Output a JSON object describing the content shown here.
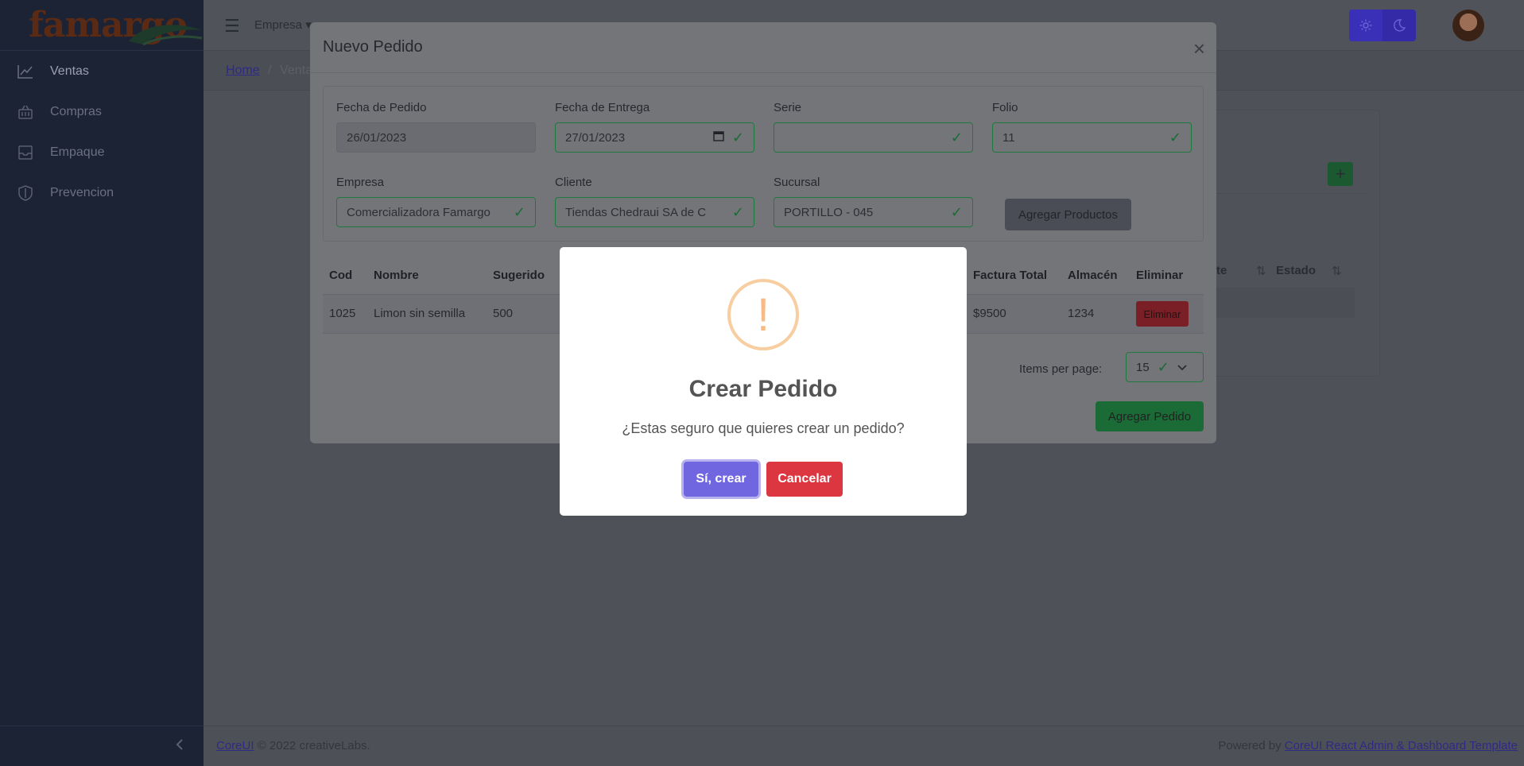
{
  "brand": {
    "logo_text": "famargo"
  },
  "sidebar": {
    "items": [
      {
        "label": "Ventas",
        "icon": "chart-line-icon"
      },
      {
        "label": "Compras",
        "icon": "basket-icon"
      },
      {
        "label": "Empaque",
        "icon": "inbox-icon"
      },
      {
        "label": "Prevencion",
        "icon": "shield-icon"
      }
    ],
    "collapse_icon": "chevron-left-icon"
  },
  "header": {
    "menu_label": "Empresa ▾"
  },
  "breadcrumb": {
    "home": "Home",
    "sep": "/",
    "current": "Venta"
  },
  "background_table": {
    "headers": [
      "te",
      "Estado"
    ]
  },
  "footer": {
    "left_link": "CoreUI",
    "left_text": "© 2022 creativeLabs.",
    "right_text": "Powered by",
    "right_link": "CoreUI React Admin & Dashboard Template"
  },
  "modal": {
    "title": "Nuevo Pedido",
    "close": "×",
    "fields": {
      "fecha_pedido": {
        "label": "Fecha de Pedido",
        "value": "26/01/2023"
      },
      "fecha_entrega": {
        "label": "Fecha de Entrega",
        "value": "27/01/2023"
      },
      "serie": {
        "label": "Serie",
        "value": ""
      },
      "folio": {
        "label": "Folio",
        "value": "11"
      },
      "empresa": {
        "label": "Empresa",
        "value": "Comercializadora Famargo"
      },
      "cliente": {
        "label": "Cliente",
        "value": "Tiendas Chedraui SA de C"
      },
      "sucursal": {
        "label": "Sucursal",
        "value": "PORTILLO - 045"
      }
    },
    "agregar_productos": "Agregar Productos",
    "table": {
      "headers": {
        "cod": "Cod",
        "nombre": "Nombre",
        "sugerido": "Sugerido",
        "factura_total": "Factura Total",
        "almacen": "Almacén",
        "eliminar": "Eliminar"
      },
      "rows": [
        {
          "cod": "1025",
          "nombre": "Limon sin semilla",
          "sugerido": "500",
          "factura_total": "$9500",
          "almacen": "1234",
          "eliminar": "Eliminar"
        }
      ]
    },
    "items_per_page_label": "Items per page:",
    "items_per_page_value": "15",
    "agregar_pedido": "Agregar Pedido"
  },
  "alert": {
    "icon": "!",
    "title": "Crear Pedido",
    "text": "¿Estas seguro que quieres crear un pedido?",
    "confirm": "Sí, crear",
    "cancel": "Cancelar"
  },
  "colors": {
    "confirm": "#7066e0",
    "cancel": "#dc3741",
    "valid": "#198754"
  }
}
